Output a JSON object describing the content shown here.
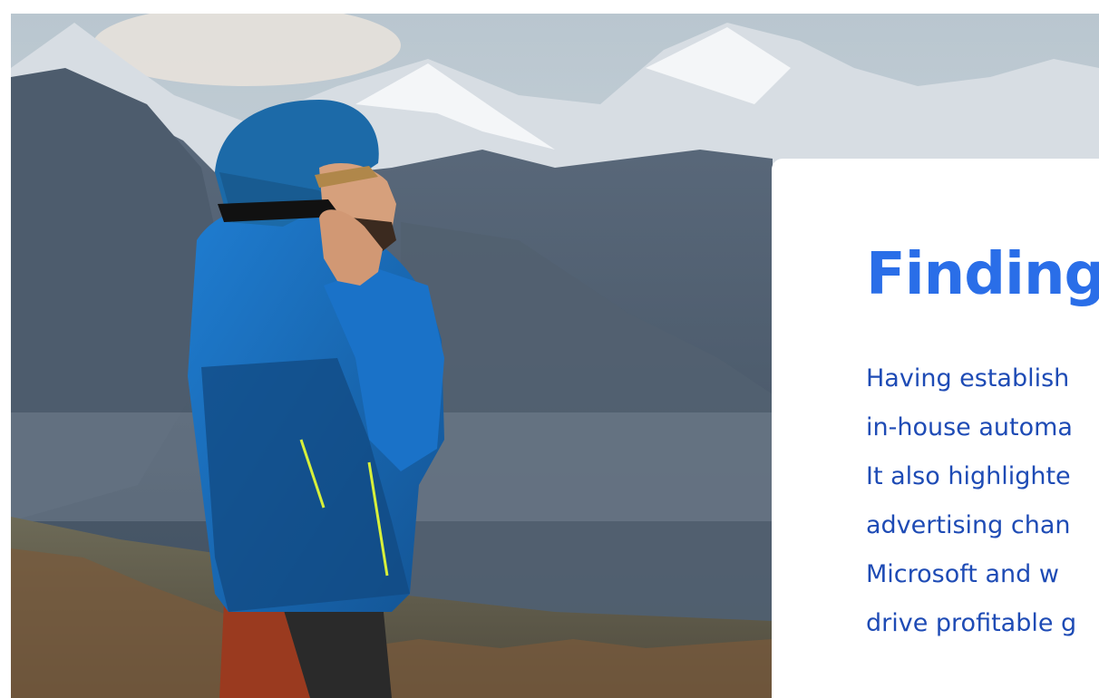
{
  "colors": {
    "title": "#2a6ee8",
    "body": "#1e4bb5",
    "sky": "#c8d4dc"
  },
  "hero": {
    "image_subject": "hiker in blue jacket talking on phone in front of snowy mountains"
  },
  "card": {
    "title": "Finding",
    "body_lines": [
      "Having establish",
      "in-house automa",
      "It also highlighte",
      "advertising chan",
      "Microsoft and w",
      "drive profitable g"
    ]
  }
}
